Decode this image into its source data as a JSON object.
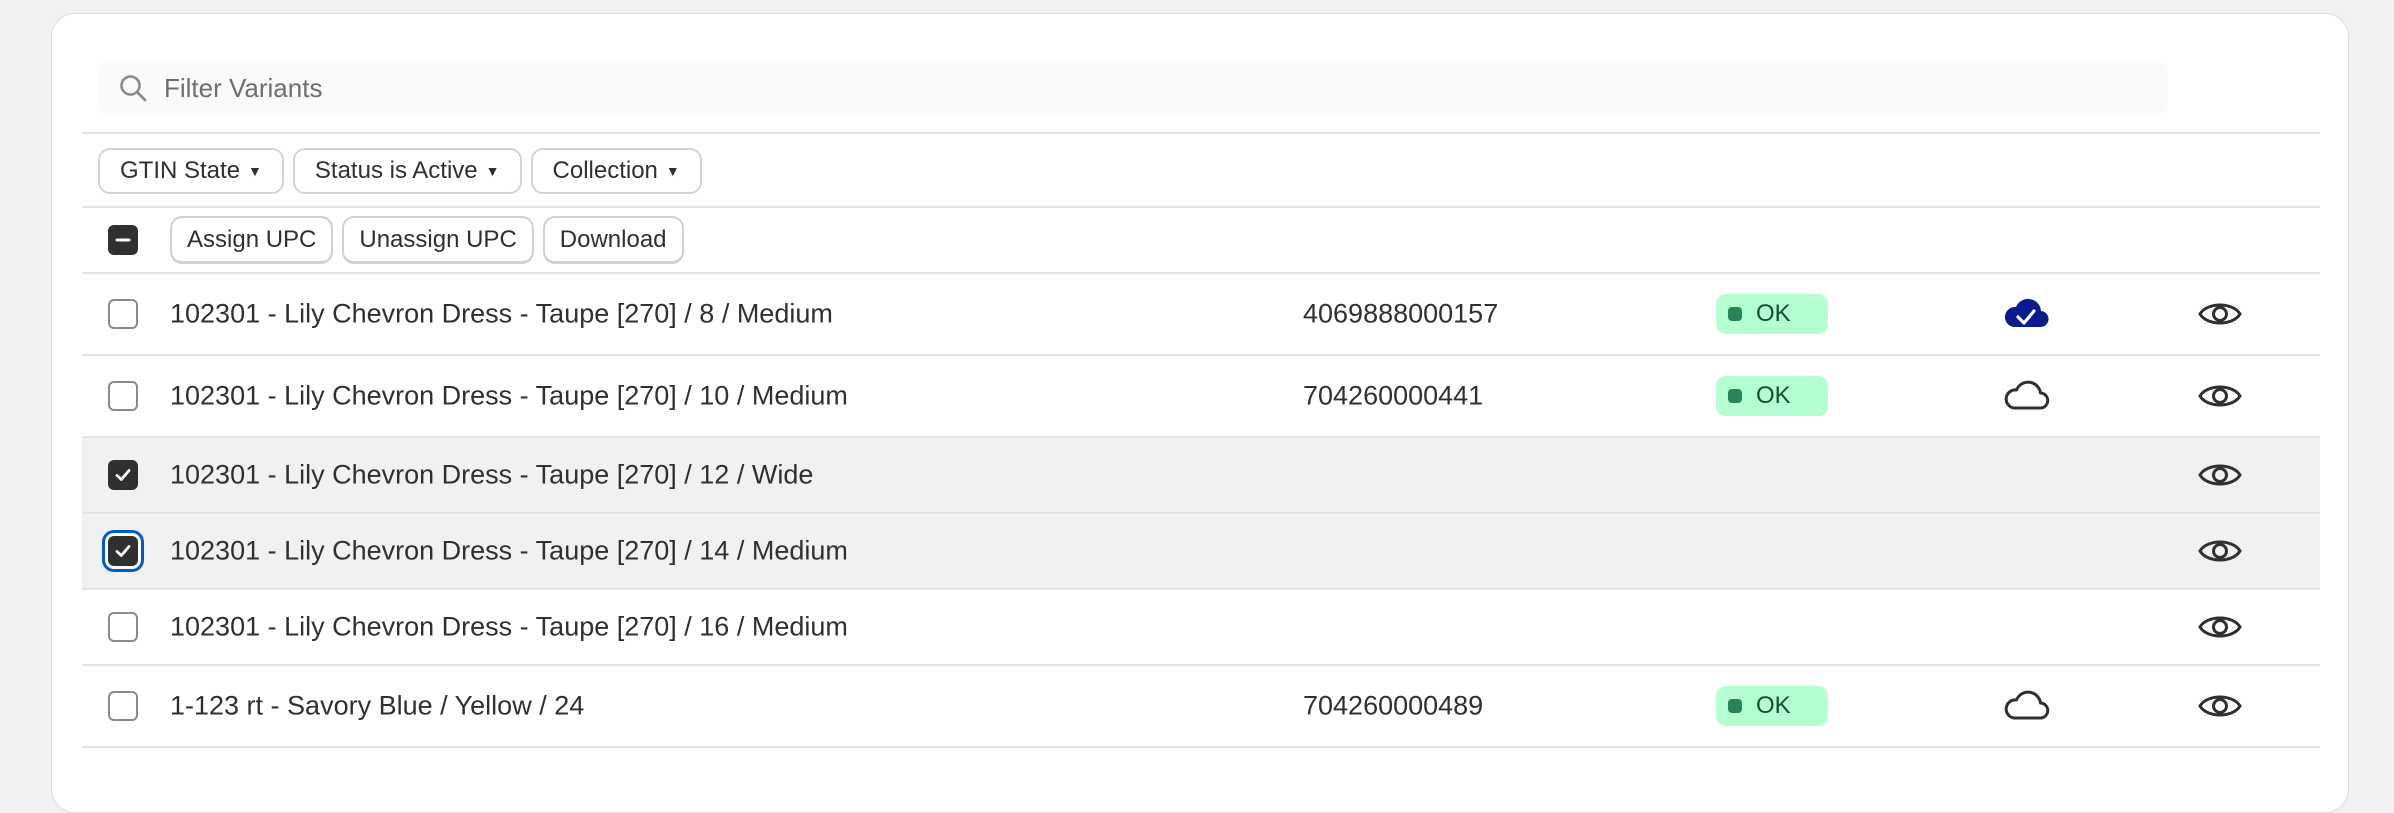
{
  "search": {
    "placeholder": "Filter Variants",
    "value": ""
  },
  "filters": [
    {
      "label": "GTIN State"
    },
    {
      "label": "Status is Active"
    },
    {
      "label": "Collection"
    }
  ],
  "bulk_actions": {
    "select_all_state": "indeterminate",
    "assign_label": "Assign UPC",
    "unassign_label": "Unassign UPC",
    "download_label": "Download"
  },
  "colors": {
    "ok_badge_bg": "#b4fed2",
    "ok_badge_text": "#0c5132",
    "synced_cloud": "#0b1a8c",
    "selected_row_bg": "#f1f1f1",
    "focus_ring": "#005bd3"
  },
  "rows": [
    {
      "name": "102301 - Lily Chevron Dress - Taupe [270] / 8 / Medium",
      "gtin": "4069888000157",
      "status": "OK",
      "sync_icon": "cloud-check-filled-icon",
      "checked": false,
      "focused": false
    },
    {
      "name": "102301 - Lily Chevron Dress - Taupe [270] / 10 / Medium",
      "gtin": "704260000441",
      "status": "OK",
      "sync_icon": "cloud-outline-icon",
      "checked": false,
      "focused": false
    },
    {
      "name": "102301 - Lily Chevron Dress - Taupe [270] / 12 / Wide",
      "gtin": "",
      "status": "",
      "sync_icon": "",
      "checked": true,
      "focused": false
    },
    {
      "name": "102301 - Lily Chevron Dress - Taupe [270] / 14 / Medium",
      "gtin": "",
      "status": "",
      "sync_icon": "",
      "checked": true,
      "focused": true
    },
    {
      "name": "102301 - Lily Chevron Dress - Taupe [270] / 16 / Medium",
      "gtin": "",
      "status": "",
      "sync_icon": "",
      "checked": false,
      "focused": false
    },
    {
      "name": "1-123 rt - Savory Blue / Yellow / 24",
      "gtin": "704260000489",
      "status": "OK",
      "sync_icon": "cloud-outline-icon",
      "checked": false,
      "focused": false
    }
  ]
}
